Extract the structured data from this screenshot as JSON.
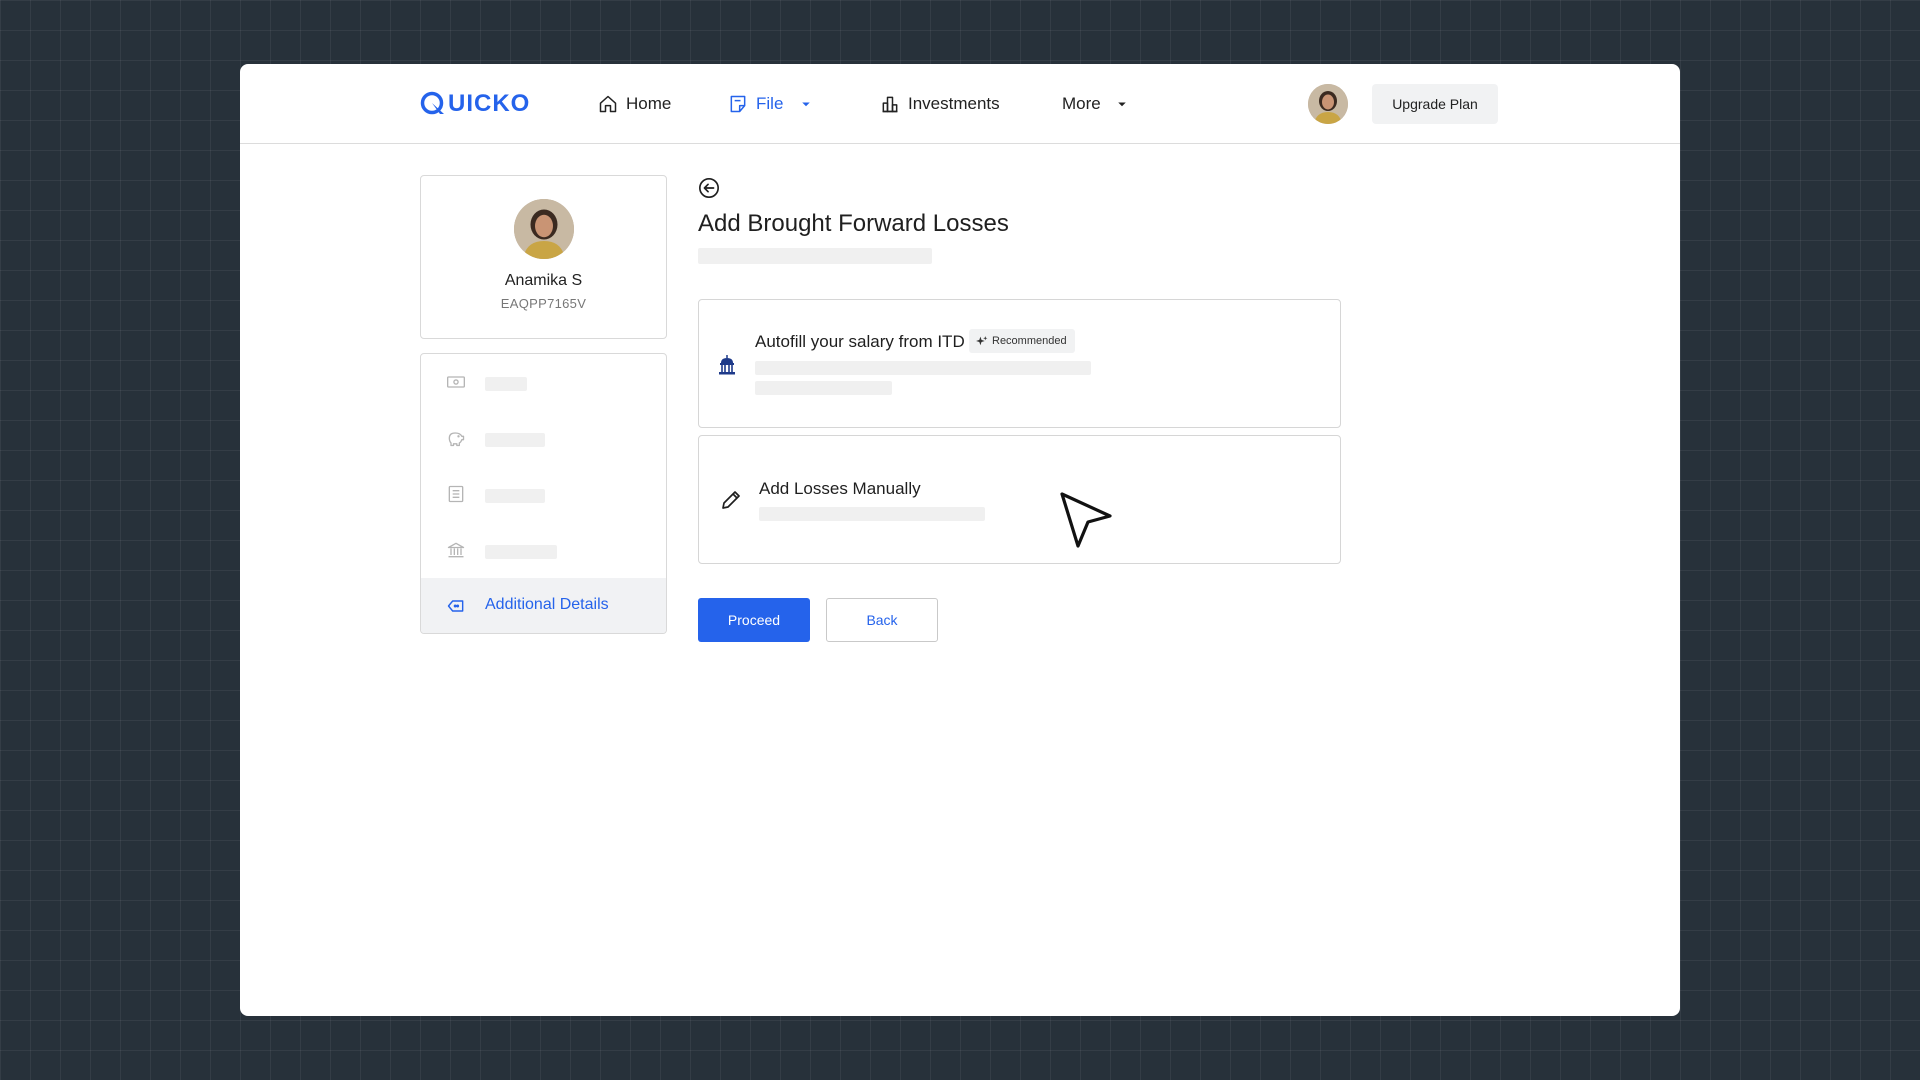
{
  "brand": {
    "name": "UICKO",
    "color": "#2563eb"
  },
  "nav": {
    "home_label": "Home",
    "file_label": "File",
    "investments_label": "Investments",
    "more_label": "More",
    "upgrade_label": "Upgrade Plan",
    "active_item": "File"
  },
  "profile": {
    "name": "Anamika S",
    "pan": "EAQPP7165V"
  },
  "sidebar": {
    "items": [
      {
        "icon": "cash-icon",
        "label": ""
      },
      {
        "icon": "piggy-bank-icon",
        "label": ""
      },
      {
        "icon": "document-icon",
        "label": ""
      },
      {
        "icon": "bank-icon",
        "label": ""
      },
      {
        "icon": "tag-icon",
        "label": "Additional Details",
        "active": true
      }
    ]
  },
  "main": {
    "title": "Add Brought Forward Losses",
    "options": [
      {
        "icon": "government-building-icon",
        "title": "Autofill your salary from ITD",
        "badge": "Recommended"
      },
      {
        "icon": "pencil-icon",
        "title": "Add Losses Manually"
      }
    ],
    "proceed_label": "Proceed",
    "back_label": "Back"
  },
  "colors": {
    "accent": "#2563eb",
    "background": "#27313a",
    "skeleton": "#f0f0f0"
  }
}
